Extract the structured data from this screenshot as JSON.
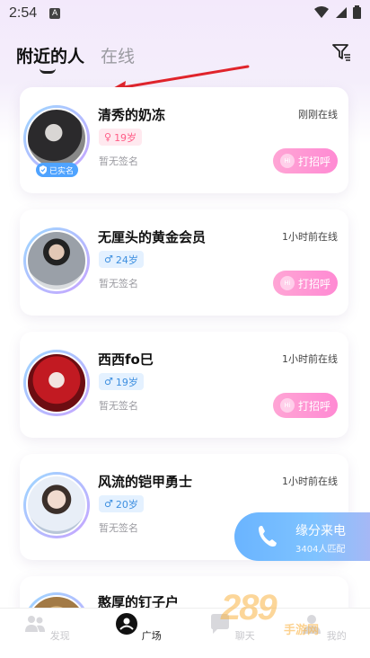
{
  "status_bar": {
    "time": "2:54"
  },
  "tabs": [
    {
      "label": "附近的人",
      "active": true
    },
    {
      "label": "在线",
      "active": false
    }
  ],
  "users": [
    {
      "name": "清秀的奶冻",
      "status": "刚刚在线",
      "gender": "female",
      "age": "19岁",
      "signature": "暂无签名",
      "verified": "已实名",
      "greet": "打招呼"
    },
    {
      "name": "无厘头的黄金会员",
      "status": "1小时前在线",
      "gender": "male",
      "age": "24岁",
      "signature": "暂无签名",
      "greet": "打招呼"
    },
    {
      "name": "西西fo巳",
      "status": "1小时前在线",
      "gender": "male",
      "age": "19岁",
      "signature": "暂无签名",
      "greet": "打招呼"
    },
    {
      "name": "风流的铠甲勇士",
      "status": "1小时前在线",
      "gender": "male",
      "age": "20岁",
      "signature": "暂无签名"
    },
    {
      "name": "憨厚的钉子户"
    }
  ],
  "floating_call": {
    "title": "缘分来电",
    "subtitle": "3404人匹配"
  },
  "bottom_nav": [
    {
      "label": "发现",
      "active": false
    },
    {
      "label": "广场",
      "active": true
    },
    {
      "label": "聊天",
      "active": false
    },
    {
      "label": "我的",
      "active": false
    }
  ],
  "watermark": {
    "main": "289",
    "sub": "手游网"
  },
  "colors": {
    "greet_gradient": "#ff8ad3",
    "female": "#ff5c86",
    "male": "#3d8fe0",
    "call_bg": "#7fc3ff",
    "annotation": "#e0242b"
  }
}
